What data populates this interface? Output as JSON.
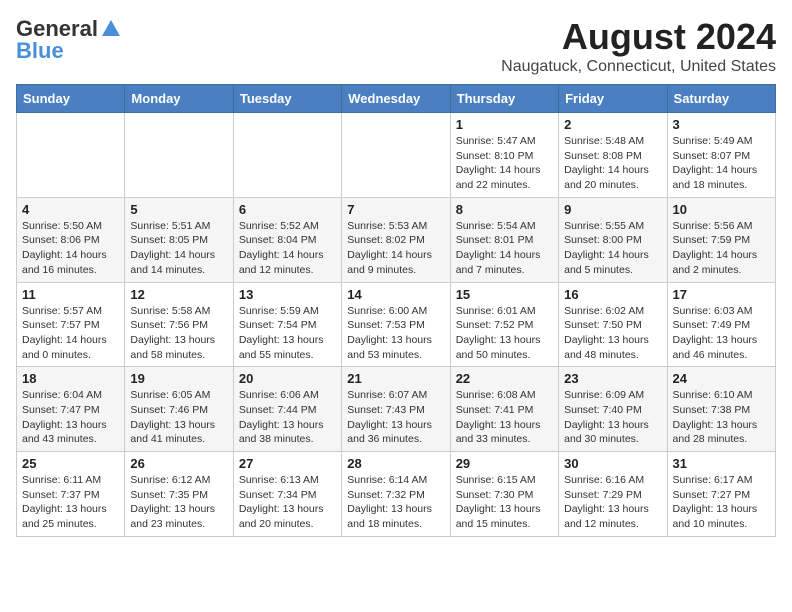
{
  "logo": {
    "general": "General",
    "blue": "Blue"
  },
  "title": "August 2024",
  "location": "Naugatuck, Connecticut, United States",
  "days_of_week": [
    "Sunday",
    "Monday",
    "Tuesday",
    "Wednesday",
    "Thursday",
    "Friday",
    "Saturday"
  ],
  "weeks": [
    [
      {
        "day": "",
        "info": ""
      },
      {
        "day": "",
        "info": ""
      },
      {
        "day": "",
        "info": ""
      },
      {
        "day": "",
        "info": ""
      },
      {
        "day": "1",
        "info": "Sunrise: 5:47 AM\nSunset: 8:10 PM\nDaylight: 14 hours\nand 22 minutes."
      },
      {
        "day": "2",
        "info": "Sunrise: 5:48 AM\nSunset: 8:08 PM\nDaylight: 14 hours\nand 20 minutes."
      },
      {
        "day": "3",
        "info": "Sunrise: 5:49 AM\nSunset: 8:07 PM\nDaylight: 14 hours\nand 18 minutes."
      }
    ],
    [
      {
        "day": "4",
        "info": "Sunrise: 5:50 AM\nSunset: 8:06 PM\nDaylight: 14 hours\nand 16 minutes."
      },
      {
        "day": "5",
        "info": "Sunrise: 5:51 AM\nSunset: 8:05 PM\nDaylight: 14 hours\nand 14 minutes."
      },
      {
        "day": "6",
        "info": "Sunrise: 5:52 AM\nSunset: 8:04 PM\nDaylight: 14 hours\nand 12 minutes."
      },
      {
        "day": "7",
        "info": "Sunrise: 5:53 AM\nSunset: 8:02 PM\nDaylight: 14 hours\nand 9 minutes."
      },
      {
        "day": "8",
        "info": "Sunrise: 5:54 AM\nSunset: 8:01 PM\nDaylight: 14 hours\nand 7 minutes."
      },
      {
        "day": "9",
        "info": "Sunrise: 5:55 AM\nSunset: 8:00 PM\nDaylight: 14 hours\nand 5 minutes."
      },
      {
        "day": "10",
        "info": "Sunrise: 5:56 AM\nSunset: 7:59 PM\nDaylight: 14 hours\nand 2 minutes."
      }
    ],
    [
      {
        "day": "11",
        "info": "Sunrise: 5:57 AM\nSunset: 7:57 PM\nDaylight: 14 hours\nand 0 minutes."
      },
      {
        "day": "12",
        "info": "Sunrise: 5:58 AM\nSunset: 7:56 PM\nDaylight: 13 hours\nand 58 minutes."
      },
      {
        "day": "13",
        "info": "Sunrise: 5:59 AM\nSunset: 7:54 PM\nDaylight: 13 hours\nand 55 minutes."
      },
      {
        "day": "14",
        "info": "Sunrise: 6:00 AM\nSunset: 7:53 PM\nDaylight: 13 hours\nand 53 minutes."
      },
      {
        "day": "15",
        "info": "Sunrise: 6:01 AM\nSunset: 7:52 PM\nDaylight: 13 hours\nand 50 minutes."
      },
      {
        "day": "16",
        "info": "Sunrise: 6:02 AM\nSunset: 7:50 PM\nDaylight: 13 hours\nand 48 minutes."
      },
      {
        "day": "17",
        "info": "Sunrise: 6:03 AM\nSunset: 7:49 PM\nDaylight: 13 hours\nand 46 minutes."
      }
    ],
    [
      {
        "day": "18",
        "info": "Sunrise: 6:04 AM\nSunset: 7:47 PM\nDaylight: 13 hours\nand 43 minutes."
      },
      {
        "day": "19",
        "info": "Sunrise: 6:05 AM\nSunset: 7:46 PM\nDaylight: 13 hours\nand 41 minutes."
      },
      {
        "day": "20",
        "info": "Sunrise: 6:06 AM\nSunset: 7:44 PM\nDaylight: 13 hours\nand 38 minutes."
      },
      {
        "day": "21",
        "info": "Sunrise: 6:07 AM\nSunset: 7:43 PM\nDaylight: 13 hours\nand 36 minutes."
      },
      {
        "day": "22",
        "info": "Sunrise: 6:08 AM\nSunset: 7:41 PM\nDaylight: 13 hours\nand 33 minutes."
      },
      {
        "day": "23",
        "info": "Sunrise: 6:09 AM\nSunset: 7:40 PM\nDaylight: 13 hours\nand 30 minutes."
      },
      {
        "day": "24",
        "info": "Sunrise: 6:10 AM\nSunset: 7:38 PM\nDaylight: 13 hours\nand 28 minutes."
      }
    ],
    [
      {
        "day": "25",
        "info": "Sunrise: 6:11 AM\nSunset: 7:37 PM\nDaylight: 13 hours\nand 25 minutes."
      },
      {
        "day": "26",
        "info": "Sunrise: 6:12 AM\nSunset: 7:35 PM\nDaylight: 13 hours\nand 23 minutes."
      },
      {
        "day": "27",
        "info": "Sunrise: 6:13 AM\nSunset: 7:34 PM\nDaylight: 13 hours\nand 20 minutes."
      },
      {
        "day": "28",
        "info": "Sunrise: 6:14 AM\nSunset: 7:32 PM\nDaylight: 13 hours\nand 18 minutes."
      },
      {
        "day": "29",
        "info": "Sunrise: 6:15 AM\nSunset: 7:30 PM\nDaylight: 13 hours\nand 15 minutes."
      },
      {
        "day": "30",
        "info": "Sunrise: 6:16 AM\nSunset: 7:29 PM\nDaylight: 13 hours\nand 12 minutes."
      },
      {
        "day": "31",
        "info": "Sunrise: 6:17 AM\nSunset: 7:27 PM\nDaylight: 13 hours\nand 10 minutes."
      }
    ]
  ]
}
